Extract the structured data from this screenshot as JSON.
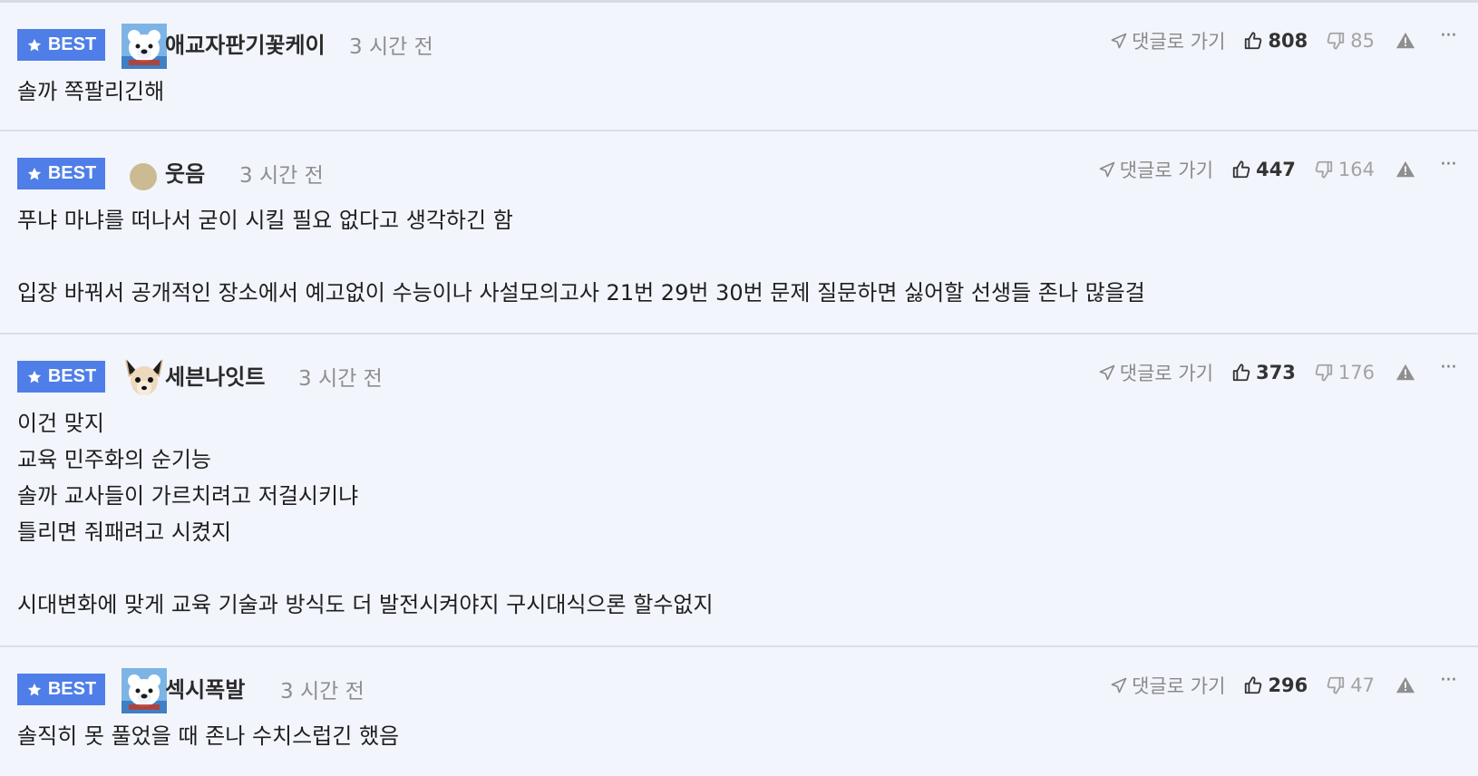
{
  "best_label": "BEST",
  "reply_label": "댓글로 가기",
  "more_label": "···",
  "comments": [
    {
      "nickname": "애교자판기꽃케이",
      "time": "3 시간 전",
      "likes": "808",
      "dislikes": "85",
      "avatar": "polar-bear-avatar",
      "lines": [
        "솔까 쪽팔리긴해"
      ]
    },
    {
      "nickname": "웃음",
      "time": "3 시간 전",
      "likes": "447",
      "dislikes": "164",
      "avatar": "default-dot-avatar",
      "lines": [
        "푸냐 마냐를 떠나서 굳이 시킬 필요 없다고 생각하긴 함",
        "",
        "입장 바꿔서 공개적인 장소에서 예고없이 수능이나 사설모의고사 21번 29번 30번 문제 질문하면 싫어할 선생들 존나 많을걸"
      ]
    },
    {
      "nickname": "세븐나잇트",
      "time": "3 시간 전",
      "likes": "373",
      "dislikes": "176",
      "avatar": "chihuahua-avatar",
      "lines": [
        "이건 맞지",
        "교육 민주화의 순기능",
        "솔까 교사들이 가르치려고 저걸시키냐",
        "틀리면 줘패려고 시켰지",
        "",
        "시대변화에 맞게 교육 기술과 방식도 더 발전시켜야지 구시대식으론 할수없지"
      ]
    },
    {
      "nickname": "섹시폭발",
      "time": "3 시간 전",
      "likes": "296",
      "dislikes": "47",
      "avatar": "polar-bear-avatar",
      "lines": [
        "솔직히 못 풀었을 때 존나 수치스럽긴 했음"
      ]
    }
  ],
  "colors": {
    "background": "#f3f5fd",
    "best_badge": "#4f7ee8",
    "divider": "#dcdee6",
    "muted_text": "#8e8e8e"
  }
}
